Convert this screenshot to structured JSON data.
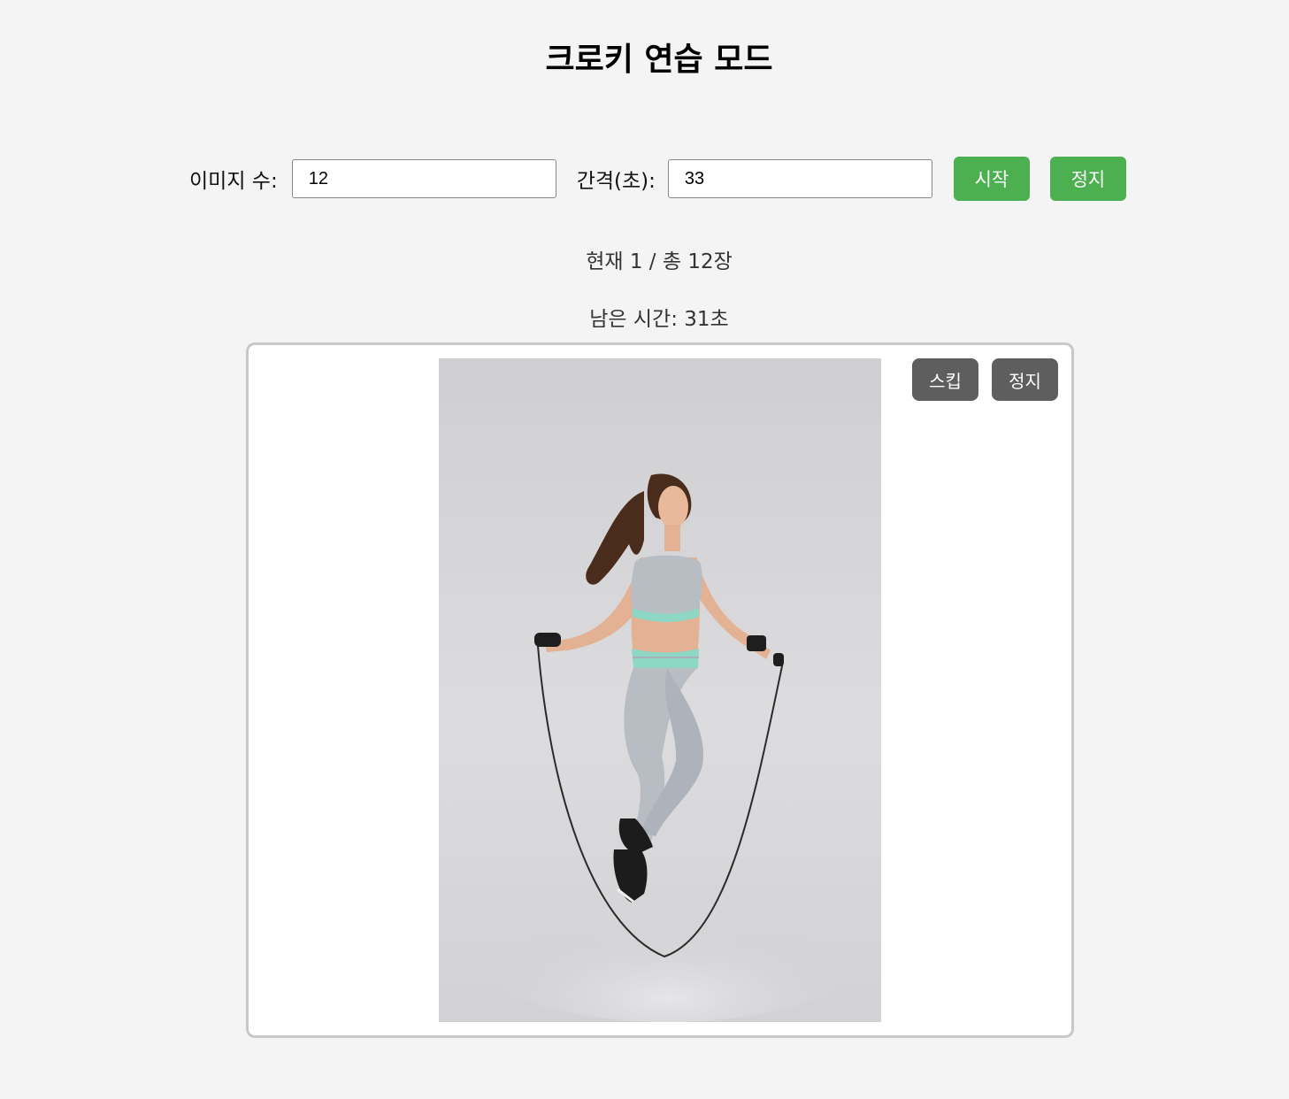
{
  "page": {
    "title": "크로키 연습 모드"
  },
  "controls": {
    "count_label": "이미지 수:",
    "count_value": "12",
    "interval_label": "간격(초):",
    "interval_value": "33",
    "start_label": "시작",
    "stop_label": "정지"
  },
  "status": {
    "progress": "현재 1 / 총 12장",
    "remaining": "남은 시간: 31초"
  },
  "viewer": {
    "skip_label": "스킵",
    "stop_label": "정지",
    "image_subject": "woman-jumping-rope"
  },
  "colors": {
    "page_bg": "#f4f4f4",
    "primary_button": "#4caf50",
    "secondary_button": "#5e5e5e",
    "viewer_border": "#c8c8c8"
  }
}
